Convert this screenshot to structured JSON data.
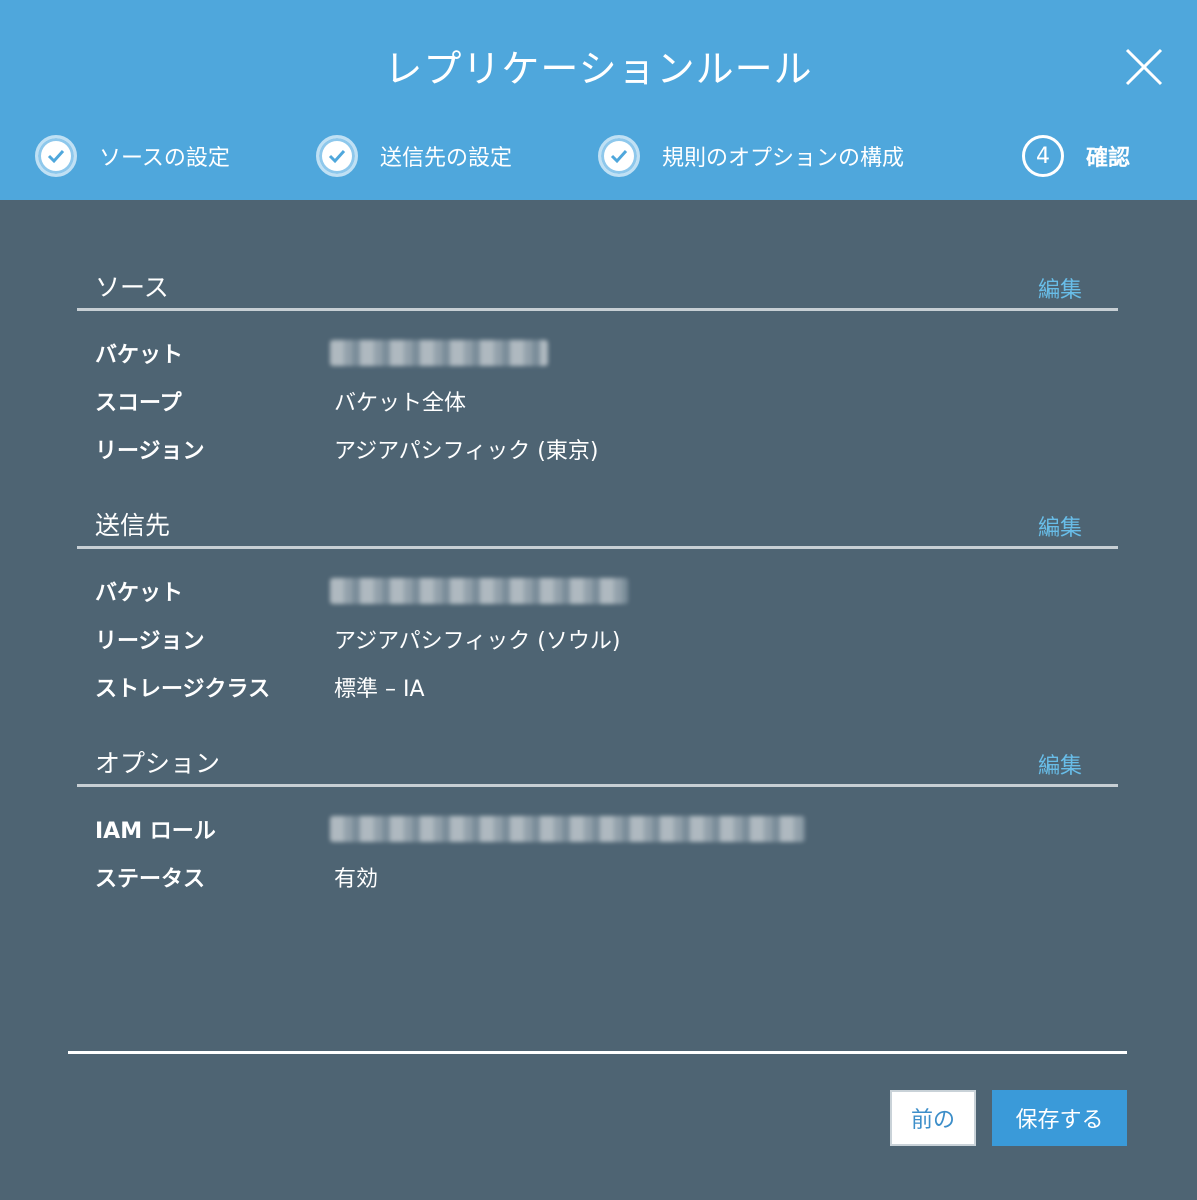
{
  "dialog": {
    "title": "レプリケーションルール",
    "close_icon": "close-icon"
  },
  "steps": [
    {
      "label": "ソースの設定",
      "status": "done",
      "icon": "check-icon"
    },
    {
      "label": "送信先の設定",
      "status": "done",
      "icon": "check-icon"
    },
    {
      "label": "規則のオプションの構成",
      "status": "done",
      "icon": "check-icon"
    },
    {
      "label": "確認",
      "status": "current",
      "number": "4"
    }
  ],
  "source": {
    "title": "ソース",
    "edit_label": "編集",
    "rows": [
      {
        "key": "バケット",
        "value": "",
        "redacted": true
      },
      {
        "key": "スコープ",
        "value": "バケット全体"
      },
      {
        "key": "リージョン",
        "value": "アジアパシフィック (東京)"
      }
    ]
  },
  "destination": {
    "title": "送信先",
    "edit_label": "編集",
    "rows": [
      {
        "key": "バケット",
        "value": "",
        "redacted": true
      },
      {
        "key": "リージョン",
        "value": "アジアパシフィック (ソウル)"
      },
      {
        "key": "ストレージクラス",
        "value": "標準 – IA"
      }
    ]
  },
  "options": {
    "title": "オプション",
    "edit_label": "編集",
    "rows": [
      {
        "key": "IAM ロール",
        "value": "",
        "redacted": true
      },
      {
        "key": "ステータス",
        "value": "有効"
      }
    ]
  },
  "footer": {
    "prev_label": "前の",
    "save_label": "保存する"
  },
  "colors": {
    "header": "#4fa7dc",
    "body": "#4e6473",
    "link": "#68bde8",
    "primary_button": "#3a9ad9"
  }
}
